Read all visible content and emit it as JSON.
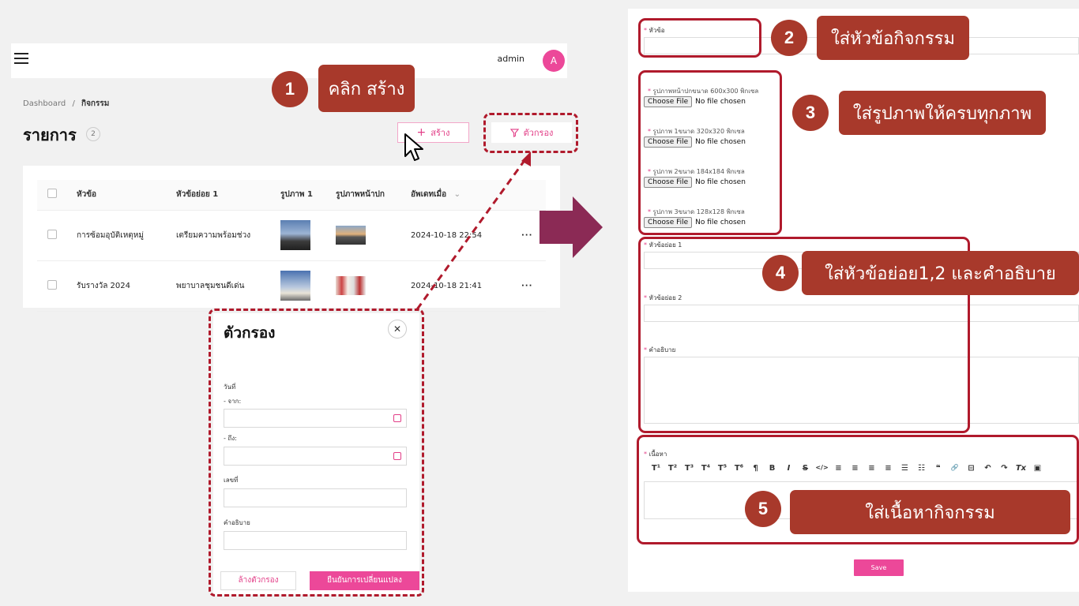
{
  "header": {
    "admin_name": "admin",
    "avatar_letter": "A"
  },
  "breadcrumb": {
    "root": "Dashboard",
    "sep": "/",
    "current": "กิจกรรม"
  },
  "page": {
    "title": "รายการ",
    "count": "2"
  },
  "actions": {
    "create_label": "สร้าง",
    "create_icon": "+",
    "filter_label": "ตัวกรอง"
  },
  "table": {
    "columns": [
      "หัวข้อ",
      "หัวข้อย่อย 1",
      "รูปภาพ 1",
      "รูปภาพหน้าปก",
      "อัพเดทเมื่อ"
    ],
    "rows": [
      {
        "title": "การซ้อมอุบัติเหตุหมู่",
        "subtitle": "เตรียมความพร้อมช่วง",
        "updated": "2024-10-18 22:54",
        "menu": "···"
      },
      {
        "title": "รับรางวัล 2024",
        "subtitle": "พยาบาลชุมชนดีเด่น",
        "updated": "2024-10-18 21:41",
        "menu": "···"
      }
    ]
  },
  "filter_dialog": {
    "title": "ตัวกรอง",
    "close": "✕",
    "date_label": "วันที่",
    "from_label": "- จาก:",
    "to_label": "- ถึง:",
    "number_label": "เลขที่",
    "desc_label": "คำอธิบาย",
    "clear_label": "ล้างตัวกรอง",
    "confirm_label": "ยืนยันการเปลี่ยนแปลง"
  },
  "steps": [
    {
      "num": "1",
      "text": "คลิก สร้าง"
    },
    {
      "num": "2",
      "text": "ใส่หัวข้อกิจกรรม"
    },
    {
      "num": "3",
      "text": "ใส่รูปภาพให้ครบทุกภาพ"
    },
    {
      "num": "4",
      "text": "ใส่หัวข้อย่อย1,2 และคำอธิบาย"
    },
    {
      "num": "5",
      "text": "ใส่เนื้อหากิจกรรม"
    }
  ],
  "form": {
    "title_label": "หัวข้อ",
    "req": "*",
    "images": [
      {
        "label": "รูปภาพหน้าปกขนาด 600x300 พิกเซล"
      },
      {
        "label": "รูปภาพ 1ขนาด 320x320 พิกเซล"
      },
      {
        "label": "รูปภาพ 2ขนาด 184x184 พิกเซล"
      },
      {
        "label": "รูปภาพ 3ขนาด 128x128 พิกเซล"
      }
    ],
    "choose_file": "Choose File",
    "no_file": "No file chosen",
    "subtitle1_label": "หัวข้อย่อย 1",
    "subtitle2_label": "หัวข้อย่อย 2",
    "desc_label": "คำอธิบาย",
    "content_label": "เนื้อหา",
    "toolbar": [
      "T¹",
      "T²",
      "T³",
      "T⁴",
      "T⁵",
      "T⁶",
      "¶",
      "B",
      "I",
      "S",
      "</>",
      "≡",
      "≡",
      "≡",
      "≡",
      "☰",
      "☷",
      "❝",
      "🔗",
      "⊟",
      "↶",
      "↷",
      "Tx",
      "▣"
    ],
    "save_label": "Save"
  },
  "colors": {
    "accent": "#ec4899",
    "callout": "#a8392b",
    "dash": "#b01a2c",
    "arrow": "#8b2a55"
  }
}
